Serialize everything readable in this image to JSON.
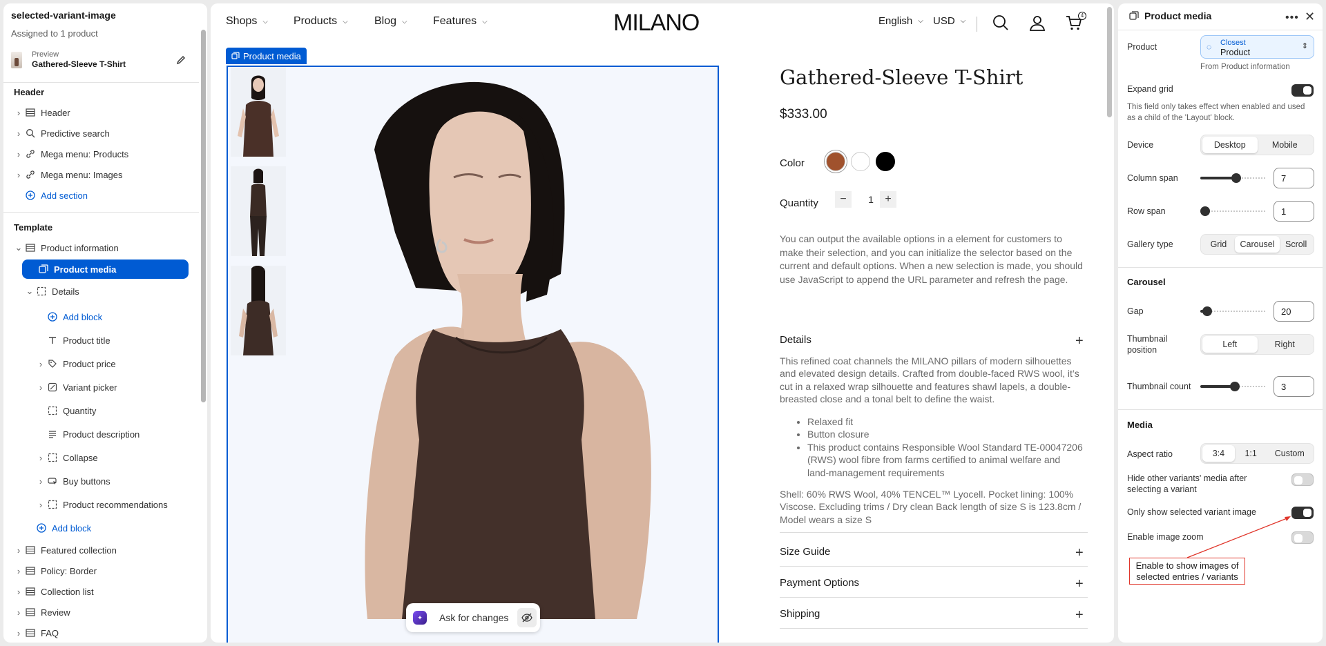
{
  "left": {
    "theme_name": "selected-variant-image",
    "assigned": "Assigned to 1 product",
    "preview_label": "Preview",
    "preview_value": "Gathered-Sleeve T-Shirt",
    "header_section": "Header",
    "header_items": [
      "Header",
      "Predictive search",
      "Mega menu: Products",
      "Mega menu: Images"
    ],
    "add_section": "Add section",
    "template_section": "Template",
    "product_information": "Product information",
    "product_media": "Product media",
    "details": "Details",
    "add_block": "Add block",
    "detail_children": [
      "Product title",
      "Product price",
      "Variant picker",
      "Quantity",
      "Product description",
      "Collapse",
      "Buy buttons",
      "Product recommendations"
    ],
    "add_block_2": "Add block",
    "footer_items": [
      "Featured collection",
      "Policy: Border",
      "Collection list",
      "Review",
      "FAQ"
    ]
  },
  "store": {
    "nav": [
      "Shops",
      "Products",
      "Blog",
      "Features"
    ],
    "logo": "MILANO",
    "language": "English",
    "currency": "USD",
    "cart_count": "4",
    "block_tag": "Product media",
    "title": "Gathered-Sleeve T-Shirt",
    "price": "$333.00",
    "color_label": "Color",
    "swatches": [
      "#a0522d",
      "#ffffff",
      "#000000"
    ],
    "quantity_label": "Quantity",
    "quantity_value": "1",
    "description": "You can output the available options in a element for customers to make their selection, and you can initialize the selector based on the current and default options. When a new selection is made, you should use JavaScript to append the URL parameter and refresh the page.",
    "details_title": "Details",
    "details_text": "This refined coat channels the MILANO pillars of modern silhouettes and elevated design details. Crafted from double-faced RWS wool, it’s cut in a relaxed wrap silhouette and features shawl lapels, a double-breasted close and a tonal belt to define the waist.",
    "details_list": [
      "Relaxed fit",
      "Button closure",
      "This product contains Responsible Wool Standard TE-00047206 (RWS) wool fibre from farms certified to animal welfare and land-management requirements"
    ],
    "details_shell": "Shell: 60% RWS Wool, 40% TENCEL™ Lyocell. Pocket lining: 100% Viscose. Excluding trims / Dry clean Back length of size S is 123.8cm / Model wears a size S",
    "accordions": [
      "Size Guide",
      "Payment Options",
      "Shipping"
    ],
    "ask_label": "Ask for changes"
  },
  "panel": {
    "title": "Product media",
    "product_label": "Product",
    "source_top": "Closest",
    "source_bottom": "Product",
    "source_from": "From Product information",
    "expand_grid_label": "Expand grid",
    "expand_grid_on": true,
    "expand_grid_help": "This field only takes effect when enabled and used as a child of the 'Layout' block.",
    "device_label": "Device",
    "device_options": [
      "Desktop",
      "Mobile"
    ],
    "device_selected": "Desktop",
    "column_span_label": "Column span",
    "column_span": "7",
    "row_span_label": "Row span",
    "row_span": "1",
    "gallery_label": "Gallery type",
    "gallery_options": [
      "Grid",
      "Carousel",
      "Scroll"
    ],
    "gallery_selected": "Carousel",
    "carousel_section": "Carousel",
    "gap_label": "Gap",
    "gap": "20",
    "thumb_pos_label": "Thumbnail position",
    "thumb_pos_options": [
      "Left",
      "Right"
    ],
    "thumb_pos_selected": "Left",
    "thumb_count_label": "Thumbnail count",
    "thumb_count": "3",
    "media_section": "Media",
    "aspect_label": "Aspect ratio",
    "aspect_options": [
      "3:4",
      "1:1",
      "Custom"
    ],
    "aspect_selected": "3:4",
    "hide_other_label": "Hide other variants' media after selecting a variant",
    "hide_other_on": false,
    "only_selected_label": "Only show selected variant image",
    "only_selected_on": true,
    "zoom_label": "Enable image zoom",
    "zoom_on": false,
    "annotation": "Enable to show images of selected entries / variants"
  },
  "colors": {
    "accent": "#005bd3",
    "annotation": "#e0362b"
  }
}
